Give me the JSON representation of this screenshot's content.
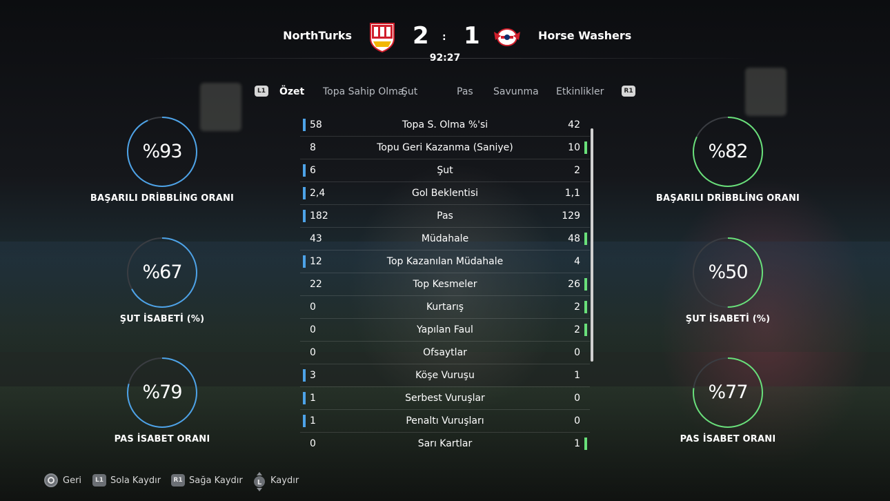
{
  "match": {
    "home_team": "NorthTurks",
    "away_team": "Horse Washers",
    "home_score": "2",
    "away_score": "1",
    "separator": ":",
    "time": "92:27"
  },
  "tabs": {
    "left_button": "L1",
    "right_button": "R1",
    "items": [
      "Özet",
      "Topa Sahip Olma",
      "Şut",
      "Pas",
      "Savunma",
      "Etkinlikler"
    ],
    "active": "Özet"
  },
  "left_circles": [
    {
      "value": "%93",
      "label": "BAŞARILI DRİBBLİNG ORANI",
      "percent": 93
    },
    {
      "value": "%67",
      "label": "ŞUT İSABETİ (%)",
      "percent": 67
    },
    {
      "value": "%79",
      "label": "PAS İSABET ORANI",
      "percent": 79
    }
  ],
  "right_circles": [
    {
      "value": "%82",
      "label": "BAŞARILI DRİBBLİNG ORANI",
      "percent": 82
    },
    {
      "value": "%50",
      "label": "ŞUT İSABETİ (%)",
      "percent": 50
    },
    {
      "value": "%77",
      "label": "PAS İSABET ORANI",
      "percent": 77
    }
  ],
  "stats": [
    {
      "home": "58",
      "label": "Topa S. Olma %'si",
      "away": "42",
      "lead": "home"
    },
    {
      "home": "8",
      "label": "Topu Geri Kazanma (Saniye)",
      "away": "10",
      "lead": "away"
    },
    {
      "home": "6",
      "label": "Şut",
      "away": "2",
      "lead": "home"
    },
    {
      "home": "2,4",
      "label": "Gol Beklentisi",
      "away": "1,1",
      "lead": "home"
    },
    {
      "home": "182",
      "label": "Pas",
      "away": "129",
      "lead": "home"
    },
    {
      "home": "43",
      "label": "Müdahale",
      "away": "48",
      "lead": "away"
    },
    {
      "home": "12",
      "label": "Top Kazanılan Müdahale",
      "away": "4",
      "lead": "home"
    },
    {
      "home": "22",
      "label": "Top Kesmeler",
      "away": "26",
      "lead": "away"
    },
    {
      "home": "0",
      "label": "Kurtarış",
      "away": "2",
      "lead": "away"
    },
    {
      "home": "0",
      "label": "Yapılan Faul",
      "away": "2",
      "lead": "away"
    },
    {
      "home": "0",
      "label": "Ofsaytlar",
      "away": "0",
      "lead": "none"
    },
    {
      "home": "3",
      "label": "Köşe Vuruşu",
      "away": "1",
      "lead": "home"
    },
    {
      "home": "1",
      "label": "Serbest Vuruşlar",
      "away": "0",
      "lead": "home"
    },
    {
      "home": "1",
      "label": "Penaltı Vuruşları",
      "away": "0",
      "lead": "home"
    },
    {
      "home": "0",
      "label": "Sarı Kartlar",
      "away": "1",
      "lead": "away"
    }
  ],
  "footer": {
    "back_label": "Geri",
    "l1_icon": "L1",
    "left_label": "Sola Kaydır",
    "r1_icon": "R1",
    "right_label": "Sağa Kaydır",
    "stick_icon": "L",
    "scroll_label": "Kaydır"
  },
  "colors": {
    "home_accent": "#4da3e8",
    "away_accent": "#69e07a",
    "ring_track": "#3a3d42"
  }
}
